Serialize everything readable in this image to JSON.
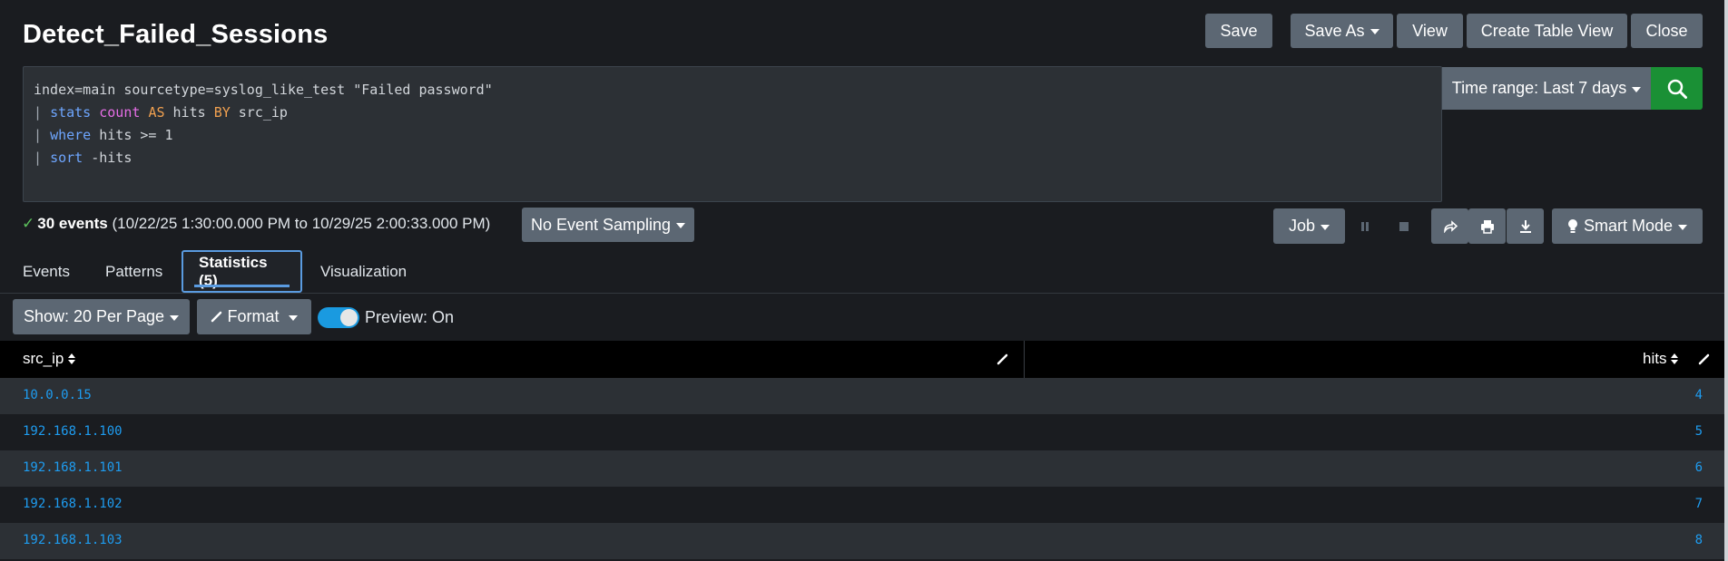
{
  "header": {
    "title": "Detect_Failed_Sessions",
    "save_label": "Save",
    "save_as_label": "Save As",
    "view_label": "View",
    "create_table_view_label": "Create Table View",
    "close_label": "Close"
  },
  "search": {
    "query_lines": [
      "index=main sourcetype=syslog_like_test \"Failed password\"",
      "| stats count AS hits BY src_ip",
      "| where hits >= 1",
      "| sort -hits"
    ],
    "time_range_label": "Time range: Last 7 days"
  },
  "status": {
    "event_count": "30 events",
    "range_text": "(10/22/25 1:30:00.000 PM to 10/29/25 2:00:33.000 PM)",
    "sampling_label": "No Event Sampling",
    "job_label": "Job",
    "mode_label": "Smart Mode"
  },
  "tabs": [
    {
      "label": "Events"
    },
    {
      "label": "Patterns"
    },
    {
      "label": "Statistics (5)"
    },
    {
      "label": "Visualization"
    }
  ],
  "results_toolbar": {
    "show_label": "Show: 20 Per Page",
    "format_label": "Format",
    "preview_label": "Preview: On",
    "preview_on": true
  },
  "table": {
    "columns": [
      "src_ip",
      "hits"
    ],
    "rows": [
      {
        "src_ip": "10.0.0.15",
        "hits": "4"
      },
      {
        "src_ip": "192.168.1.100",
        "hits": "5"
      },
      {
        "src_ip": "192.168.1.101",
        "hits": "6"
      },
      {
        "src_ip": "192.168.1.102",
        "hits": "7"
      },
      {
        "src_ip": "192.168.1.103",
        "hits": "8"
      }
    ]
  },
  "colors": {
    "background": "#1a1c20",
    "button": "#5c6773",
    "search_green": "#1a9035",
    "link_blue": "#1e9cf0",
    "active_tab": "#5a9be0"
  }
}
